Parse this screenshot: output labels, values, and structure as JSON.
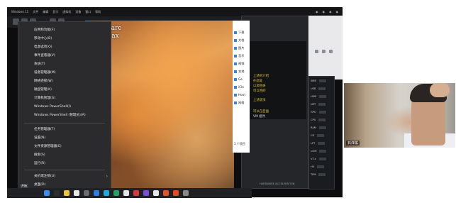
{
  "menubar": {
    "items": [
      "Windows 11",
      "文件",
      "编辑",
      "显示",
      "虚拟机",
      "设备",
      "窗口",
      "帮助"
    ],
    "right": [
      "◉",
      "◉",
      "◉",
      "◉"
    ]
  },
  "context_menu": {
    "items": [
      {
        "label": "应用和功能(F)",
        "sub": false
      },
      {
        "label": "移动中心(B)",
        "sub": false
      },
      {
        "label": "电源选项(O)",
        "sub": false
      },
      {
        "label": "事件查看器(V)",
        "sub": false
      },
      {
        "label": "系统(Y)",
        "sub": false
      },
      {
        "label": "设备管理器(M)",
        "sub": false
      },
      {
        "label": "网络连接(W)",
        "sub": false
      },
      {
        "label": "磁盘管理(K)",
        "sub": false
      },
      {
        "label": "计算机管理(G)",
        "sub": false
      },
      {
        "label": "Windows PowerShell(I)",
        "sub": false
      },
      {
        "label": "Windows PowerShell (管理员)(A)",
        "sub": false
      },
      {
        "label": "任务管理器(T)",
        "sub": false
      },
      {
        "label": "设置(N)",
        "sub": false
      },
      {
        "label": "文件资源管理器(E)",
        "sub": false
      },
      {
        "label": "搜索(S)",
        "sub": false
      },
      {
        "label": "运行(R)",
        "sub": false
      },
      {
        "label": "关机或注销(U)",
        "sub": true
      },
      {
        "label": "桌面(D)",
        "sub": false
      }
    ]
  },
  "wallpaper": {
    "brand_line1": "rshare",
    "brand_line2": "Max"
  },
  "explorer": {
    "items": [
      "下载",
      "文档",
      "图片",
      "音乐",
      "视频",
      "本地",
      "Ge",
      "iClo",
      "Hom",
      "网络"
    ],
    "status": "1 个项目"
  },
  "settings": {
    "lines": [
      "上述的介绍",
      "在此处",
      "以及相关",
      "可以用的",
      "上述说法",
      "可以在后面",
      "VM 组件"
    ],
    "footer": "HARDWARE ACCELERATION"
  },
  "right_panel": {
    "rows": [
      "SMB",
      "USB",
      "HDD",
      "NET",
      "GPU",
      "CPU",
      "RAM",
      "CD",
      "LPT",
      "COM",
      "VT-x",
      "HV",
      "TPM"
    ]
  },
  "taskbar": {
    "start_label": "开始",
    "icons": [
      "#3b8ee8",
      "#2f2f2f",
      "#f0c33c",
      "#e8e8e8",
      "#6b6b6b",
      "#2a7de1",
      "#1fa9e0",
      "#26a269",
      "#e8e8e8",
      "#d83b3b",
      "#7a4fd6",
      "#e8e8e8",
      "#e0532f",
      "#e34c26",
      "#8a8a8a"
    ]
  },
  "webcam": {
    "name": "石洋佑"
  }
}
